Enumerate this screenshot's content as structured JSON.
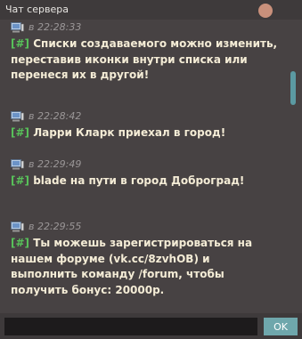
{
  "window": {
    "title": "Чат сервера"
  },
  "colors": {
    "background": "#474243",
    "tag": "#58c25a",
    "message_text": "#f4ecd6",
    "timestamp": "#9a9697",
    "scrollbar": "#5b9aa2",
    "ok_button": "#6fa7ac",
    "close_button": "#c9907b"
  },
  "messages": [
    {
      "icon": "computer-icon",
      "time": "в 22:28:33",
      "tag": "[#]",
      "text": "Списки создаваемого можно изменить, переставив иконки внутри списка или перенеся их в другой!"
    },
    {
      "icon": "computer-icon",
      "time": "в 22:28:42",
      "tag": "[#]",
      "text": "Ларри Кларк приехал в город!"
    },
    {
      "icon": "computer-icon",
      "time": "в 22:29:49",
      "tag": "[#]",
      "text": "blade на пути в город Доброград!"
    },
    {
      "icon": "computer-icon",
      "time": "в 22:29:55",
      "tag": "[#]",
      "text": "Ты можешь зарегистрироваться на нашем форуме (vk.cc/8zvhOB) и выполнить команду /forum, чтобы получить бонус: 20000р."
    }
  ],
  "input": {
    "value": "",
    "placeholder": ""
  },
  "ok_label": "OK"
}
